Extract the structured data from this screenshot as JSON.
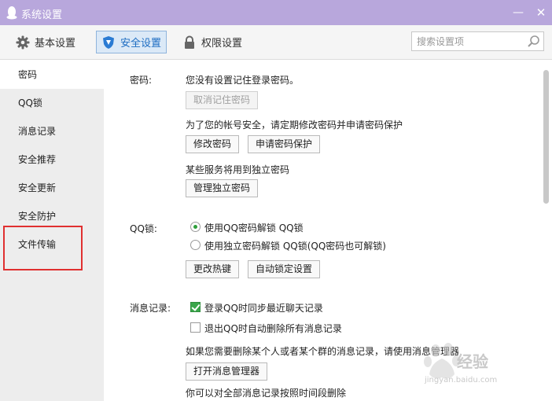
{
  "window": {
    "title": "系统设置",
    "minimize_glyph": "—",
    "close_glyph": "✕"
  },
  "toolbar": {
    "tabs": [
      {
        "label": "基本设置",
        "icon": "gear-icon"
      },
      {
        "label": "安全设置",
        "icon": "shield-icon",
        "active": true
      },
      {
        "label": "权限设置",
        "icon": "lock-icon"
      }
    ],
    "search_placeholder": "搜索设置项"
  },
  "sidebar": {
    "items": [
      {
        "label": "密码",
        "active": true
      },
      {
        "label": "QQ锁"
      },
      {
        "label": "消息记录"
      },
      {
        "label": "安全推荐"
      },
      {
        "label": "安全更新"
      },
      {
        "label": "安全防护"
      },
      {
        "label": "文件传输",
        "highlighted": true
      }
    ]
  },
  "password": {
    "label": "密码:",
    "status": "您没有设置记住登录密码。",
    "cancel_remember_btn": "取消记住密码",
    "advice": "为了您的帐号安全，请定期修改密码并申请密码保护",
    "change_btn": "修改密码",
    "apply_protect_btn": "申请密码保护",
    "independent_hint": "某些服务将用到独立密码",
    "manage_independent_btn": "管理独立密码"
  },
  "qqlock": {
    "label": "QQ锁:",
    "option1": "使用QQ密码解锁 QQ锁",
    "option2": "使用独立密码解锁 QQ锁(QQ密码也可解锁)",
    "selected": 1,
    "hotkey_btn": "更改热键",
    "autolock_btn": "自动锁定设置"
  },
  "messages": {
    "label": "消息记录:",
    "sync_option": "登录QQ时同步最近聊天记录",
    "sync_checked": true,
    "delete_on_exit_option": "退出QQ时自动删除所有消息记录",
    "delete_on_exit_checked": false,
    "manager_hint": "如果您需要删除某个人或者某个群的消息记录，请使用消息管理器",
    "open_manager_btn": "打开消息管理器",
    "period_hint": "你可以对全部消息记录按照时间段删除"
  },
  "watermark": {
    "text": "经验",
    "url": "jingyan.baidu.com"
  },
  "colors": {
    "titlebar": "#b8a7dc",
    "active_tab_bg": "#dbe9f7",
    "active_tab_text": "#1c6cc2",
    "highlight_red": "#e03030",
    "check_green": "#3aa64a"
  }
}
